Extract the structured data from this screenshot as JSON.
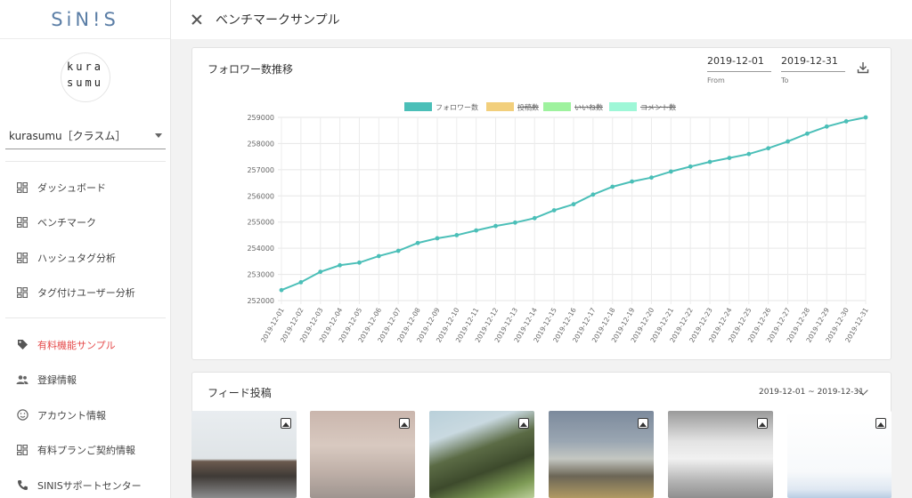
{
  "app": {
    "logo": "SiN!S"
  },
  "account": {
    "avatar_line1": "kura",
    "avatar_line2": "sumu",
    "select_value": "kurasumu［クラスム］"
  },
  "sidebar": {
    "group1": [
      {
        "label": "ダッシュボード",
        "icon": "dashboard-icon"
      },
      {
        "label": "ベンチマーク",
        "icon": "dashboard-icon"
      },
      {
        "label": "ハッシュタグ分析",
        "icon": "dashboard-icon"
      },
      {
        "label": "タグ付けユーザー分析",
        "icon": "dashboard-icon"
      }
    ],
    "group2": [
      {
        "label": "有料機能サンプル",
        "icon": "tag-icon",
        "active": true
      },
      {
        "label": "登録情報",
        "icon": "people-icon"
      },
      {
        "label": "アカウント情報",
        "icon": "smile-icon"
      },
      {
        "label": "有料プランご契約情報",
        "icon": "dashboard-icon"
      },
      {
        "label": "SINISサポートセンター",
        "icon": "phone-icon"
      }
    ]
  },
  "header": {
    "title": "ベンチマークサンプル"
  },
  "follower_card": {
    "title": "フォロワー数推移",
    "from_value": "2019-12-01",
    "from_label": "From",
    "to_value": "2019-12-31",
    "to_label": "To"
  },
  "feed_card": {
    "title": "フィード投稿",
    "range": "2019-12-01 ~ 2019-12-31"
  },
  "colors": {
    "accent_red": "#e54b4b",
    "line": "#4bbfb8",
    "posts": "#f2cf7c",
    "likes": "#9ef29e",
    "comments": "#9ef7d7"
  },
  "chart_data": {
    "type": "line",
    "legend_position": "top",
    "series": [
      {
        "name": "フォロワー数",
        "color": "#4bbfb8",
        "hidden": false,
        "values": [
          252400,
          252700,
          253100,
          253350,
          253450,
          253700,
          253900,
          254200,
          254380,
          254500,
          254680,
          254850,
          254980,
          255150,
          255450,
          255680,
          256050,
          256350,
          256550,
          256700,
          256930,
          257120,
          257300,
          257450,
          257600,
          257820,
          258080,
          258380,
          258650,
          258850,
          259000
        ]
      },
      {
        "name": "投稿数",
        "color": "#f2cf7c",
        "hidden": true,
        "values": []
      },
      {
        "name": "いいね数",
        "color": "#9ef29e",
        "hidden": true,
        "values": []
      },
      {
        "name": "コメント数",
        "color": "#9ef7d7",
        "hidden": true,
        "values": []
      }
    ],
    "categories": [
      "2019-12-01",
      "2019-12-02",
      "2019-12-03",
      "2019-12-04",
      "2019-12-05",
      "2019-12-06",
      "2019-12-07",
      "2019-12-08",
      "2019-12-09",
      "2019-12-10",
      "2019-12-11",
      "2019-12-12",
      "2019-12-13",
      "2019-12-14",
      "2019-12-15",
      "2019-12-16",
      "2019-12-17",
      "2019-12-18",
      "2019-12-19",
      "2019-12-20",
      "2019-12-21",
      "2019-12-22",
      "2019-12-23",
      "2019-12-24",
      "2019-12-25",
      "2019-12-26",
      "2019-12-27",
      "2019-12-28",
      "2019-12-29",
      "2019-12-30",
      "2019-12-31"
    ],
    "yticks": [
      "252000",
      "253000",
      "254000",
      "255000",
      "256000",
      "257000",
      "258000",
      "259000"
    ],
    "ylim": [
      252000,
      259000
    ],
    "grid": true
  },
  "thumbnails": [
    {
      "name": "thumb-1"
    },
    {
      "name": "thumb-2"
    },
    {
      "name": "thumb-3"
    },
    {
      "name": "thumb-4"
    },
    {
      "name": "thumb-5"
    },
    {
      "name": "thumb-6"
    }
  ]
}
